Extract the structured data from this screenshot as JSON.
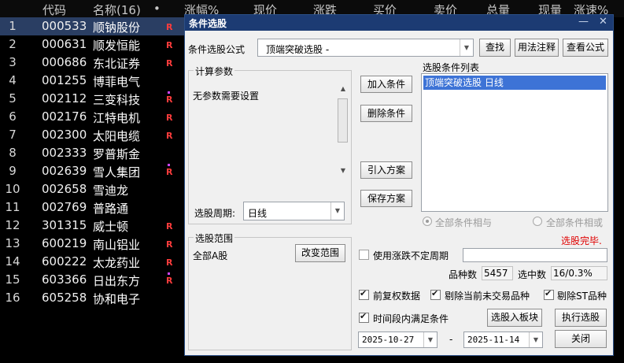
{
  "table": {
    "headers": [
      "代码",
      "名称(16)",
      "•",
      "涨幅%",
      "现价",
      "涨跌",
      "买价",
      "卖价",
      "总量",
      "现量",
      "涨速%"
    ],
    "rows": [
      {
        "idx": "1",
        "code": "000533",
        "name": "顺钠股份",
        "flag": "R",
        "dot": false
      },
      {
        "idx": "2",
        "code": "000631",
        "name": "顺发恒能",
        "flag": "R",
        "dot": false
      },
      {
        "idx": "3",
        "code": "000686",
        "name": "东北证券",
        "flag": "R",
        "dot": false
      },
      {
        "idx": "4",
        "code": "001255",
        "name": "博菲电气",
        "flag": "",
        "dot": false
      },
      {
        "idx": "5",
        "code": "002112",
        "name": "三变科技",
        "flag": "R",
        "dot": true
      },
      {
        "idx": "6",
        "code": "002176",
        "name": "江特电机",
        "flag": "R",
        "dot": false
      },
      {
        "idx": "7",
        "code": "002300",
        "name": "太阳电缆",
        "flag": "R",
        "dot": false
      },
      {
        "idx": "8",
        "code": "002333",
        "name": "罗普斯金",
        "flag": "",
        "dot": false
      },
      {
        "idx": "9",
        "code": "002639",
        "name": "雪人集团",
        "flag": "R",
        "dot": true
      },
      {
        "idx": "10",
        "code": "002658",
        "name": "雪迪龙",
        "flag": "",
        "dot": false
      },
      {
        "idx": "11",
        "code": "002769",
        "name": "普路通",
        "flag": "",
        "dot": false
      },
      {
        "idx": "12",
        "code": "301315",
        "name": "威士顿",
        "flag": "R",
        "dot": false
      },
      {
        "idx": "13",
        "code": "600219",
        "name": "南山铝业",
        "flag": "R",
        "dot": false
      },
      {
        "idx": "14",
        "code": "600222",
        "name": "太龙药业",
        "flag": "R",
        "dot": false
      },
      {
        "idx": "15",
        "code": "603366",
        "name": "日出东方",
        "flag": "R",
        "dot": true
      },
      {
        "idx": "16",
        "code": "605258",
        "name": "协和电子",
        "flag": "",
        "dot": false
      }
    ]
  },
  "dialog": {
    "title": "条件选股",
    "formula_label": "条件选股公式",
    "formula_value": "顶端突破选股  -",
    "find_button": "查找",
    "usage_button": "用法注释",
    "view_formula_button": "查看公式",
    "params_group": "计算参数",
    "params_text": "无参数需要设置",
    "add_condition": "加入条件",
    "delete_condition": "删除条件",
    "import_plan": "引入方案",
    "save_plan": "保存方案",
    "condition_list_label": "选股条件列表",
    "condition_item": "顶端突破选股  日线",
    "period_label": "选股周期:",
    "period_value": "日线",
    "radio_and": "全部条件相与",
    "radio_or": "全部条件相或",
    "status": "选股完毕.",
    "range_group": "选股范围",
    "range_text": "全部A股",
    "change_range": "改变范围",
    "use_uncertain_period": "使用涨跌不定周期",
    "stock_count_label": "品种数",
    "stock_count": "5457",
    "selected_label": "选中数",
    "selected_value": "16/0.3%",
    "pre_rights": "前复权数据",
    "remove_untraded": "剔除当前未交易品种",
    "remove_st": "剔除ST品种",
    "time_range": "时间段内满足条件",
    "to_board": "选股入板块",
    "execute": "执行选股",
    "date_from": "2025-10-27",
    "date_sep": "-",
    "date_to": "2025-11-14",
    "close": "关闭",
    "status_color": "#e00000"
  }
}
